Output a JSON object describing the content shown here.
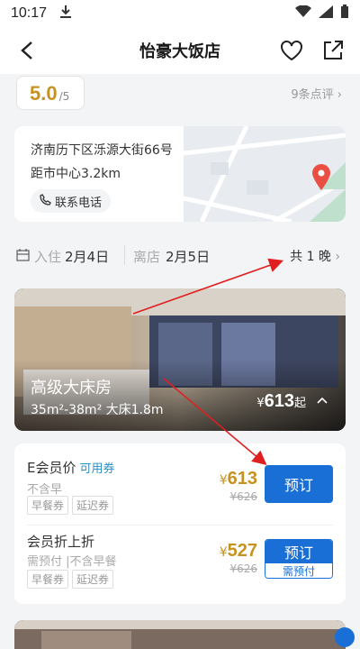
{
  "status": {
    "time": "10:17",
    "icons": [
      "download-icon",
      "wifi-icon",
      "signal-icon",
      "battery-icon"
    ]
  },
  "header": {
    "title": "怡豪大饭店"
  },
  "rating": {
    "score": "5.0",
    "outof": "/5",
    "reviews": "9条点评"
  },
  "address": {
    "line": "济南历下区泺源大街66号",
    "distance": "距市中心3.2km",
    "phone_label": "联系电话"
  },
  "dates": {
    "checkin_label": "入住",
    "checkin_date": "2月4日",
    "checkout_label": "离店",
    "checkout_date": "2月5日",
    "nights": "共 1 晚"
  },
  "room": {
    "name": "高级大床房",
    "desc": "35m²-38m² 大床1.8m",
    "currency": "¥",
    "price": "613",
    "suffix": "起"
  },
  "rates": [
    {
      "name": "E会员价",
      "tag": "可用券",
      "sub": "不含早",
      "chips": [
        "早餐券",
        "延迟券"
      ],
      "currency": "¥",
      "price": "613",
      "orig": "¥626",
      "book": "预订"
    },
    {
      "name": "会员折上折",
      "sub": "需预付 |不含早餐",
      "chips": [
        "早餐券",
        "延迟券"
      ],
      "currency": "¥",
      "price": "527",
      "orig": "¥626",
      "book": "预订",
      "book_sub": "需预付"
    }
  ],
  "colors": {
    "accent": "#1a6fd6",
    "price": "#c7921f",
    "arrow": "#e02020"
  }
}
